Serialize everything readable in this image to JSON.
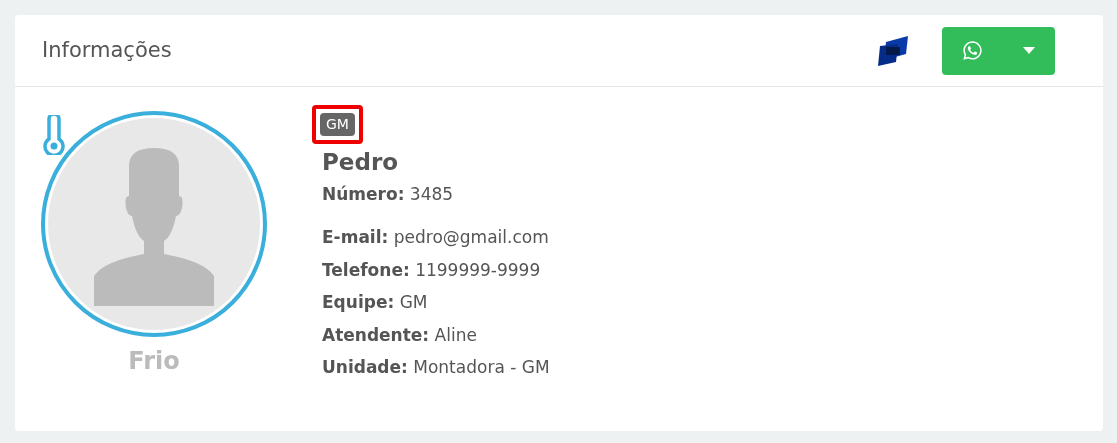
{
  "card": {
    "title": "Informações"
  },
  "header_actions": {
    "whatsapp_button": {
      "has_dropdown": true
    }
  },
  "profile": {
    "temperature": {
      "label": "Frio",
      "color": "#3aafdb"
    },
    "tag": {
      "label": "GM",
      "highlighted": true
    },
    "name": "Pedro",
    "number": {
      "label": "Número:",
      "value": "3485"
    },
    "fields": [
      {
        "label": "E-mail:",
        "value": "pedro@gmail.com"
      },
      {
        "label": "Telefone:",
        "value": "1199999-9999"
      },
      {
        "label": "Equipe:",
        "value": "GM"
      },
      {
        "label": "Atendente:",
        "value": "Aline"
      },
      {
        "label": "Unidade:",
        "value": "Montadora - GM"
      }
    ]
  }
}
